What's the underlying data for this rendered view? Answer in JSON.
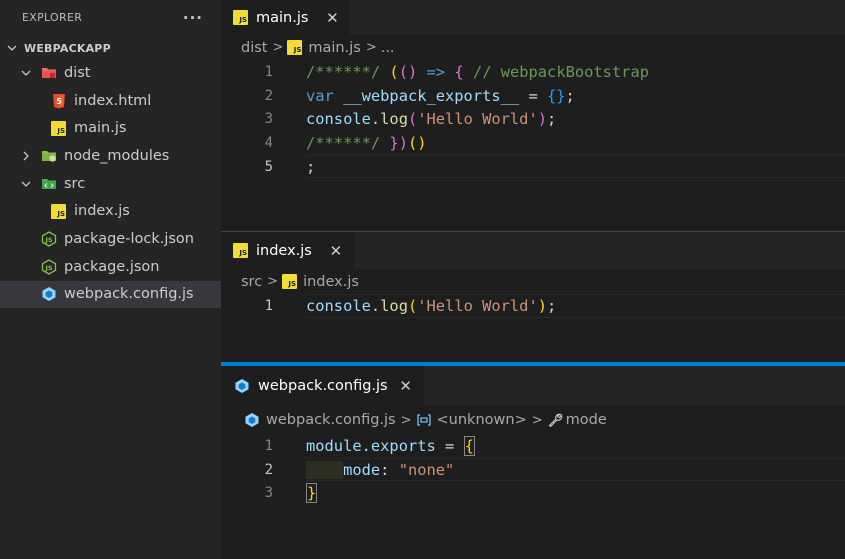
{
  "explorer": {
    "title": "EXPLORER",
    "more_label": "···",
    "root": "WEBPACKAPP",
    "items": [
      {
        "label": "dist",
        "type": "folder",
        "icon": "dist-folder-icon",
        "expanded": true
      },
      {
        "label": "index.html",
        "type": "file",
        "icon": "html-file-icon"
      },
      {
        "label": "main.js",
        "type": "file",
        "icon": "js-file-icon"
      },
      {
        "label": "node_modules",
        "type": "folder",
        "icon": "node-folder-icon",
        "expanded": false
      },
      {
        "label": "src",
        "type": "folder",
        "icon": "src-folder-icon",
        "expanded": true
      },
      {
        "label": "index.js",
        "type": "file",
        "icon": "js-file-icon"
      },
      {
        "label": "package-lock.json",
        "type": "file",
        "icon": "node-json-icon"
      },
      {
        "label": "package.json",
        "type": "file",
        "icon": "node-json-icon"
      },
      {
        "label": "webpack.config.js",
        "type": "file",
        "icon": "webpack-icon",
        "selected": true
      }
    ]
  },
  "js_badge": "JS",
  "groups": [
    {
      "tab": "main.js",
      "close": "✕",
      "breadcrumb": {
        "folder": "dist",
        "file": "main.js",
        "more": "..."
      },
      "lines": [
        "1",
        "2",
        "3",
        "4",
        "5"
      ]
    },
    {
      "tab": "index.js",
      "close": "✕",
      "breadcrumb": {
        "folder": "src",
        "file": "index.js"
      },
      "lines": [
        "1"
      ]
    },
    {
      "tab": "webpack.config.js",
      "close": "✕",
      "breadcrumb": {
        "file": "webpack.config.js",
        "symbol": "<unknown>",
        "property": "mode"
      },
      "lines": [
        "1",
        "2",
        "3"
      ]
    }
  ],
  "code": {
    "main": {
      "l1": {
        "c1": "/******/",
        "b1": "(",
        "b2": "()",
        "arrow": "=>",
        "b3": "{",
        "c2": "// webpackBootstrap"
      },
      "l2": {
        "kw": "var",
        "v": "__webpack_exports__",
        "eq": "=",
        "b": "{}",
        "semi": ";"
      },
      "l3": {
        "obj": "console",
        "dot": ".",
        "fn": "log",
        "p1": "(",
        "str": "'Hello World'",
        "p2": ")",
        "semi": ";"
      },
      "l4": {
        "c1": "/******/",
        "b3": "}",
        "b2": ")",
        "b1": "()"
      },
      "l5": ";"
    },
    "index": {
      "l1": {
        "obj": "console",
        "dot": ".",
        "fn": "log",
        "p1": "(",
        "str": "'Hello World'",
        "p2": ")",
        "semi": ";"
      }
    },
    "config": {
      "l1": {
        "obj": "module",
        "dot": ".",
        "prop": "exports",
        "eq": "=",
        "b": "{"
      },
      "l2": {
        "key": "mode",
        "colon": ":",
        "str": "\"none\""
      },
      "l3": "}"
    }
  },
  "colors": {
    "accent": "#007fd4",
    "js_yellow": "#f1dd35",
    "html_orange": "#e44d26",
    "node_green": "#8bc34a",
    "webpack_blue": "#8ed6fb"
  }
}
